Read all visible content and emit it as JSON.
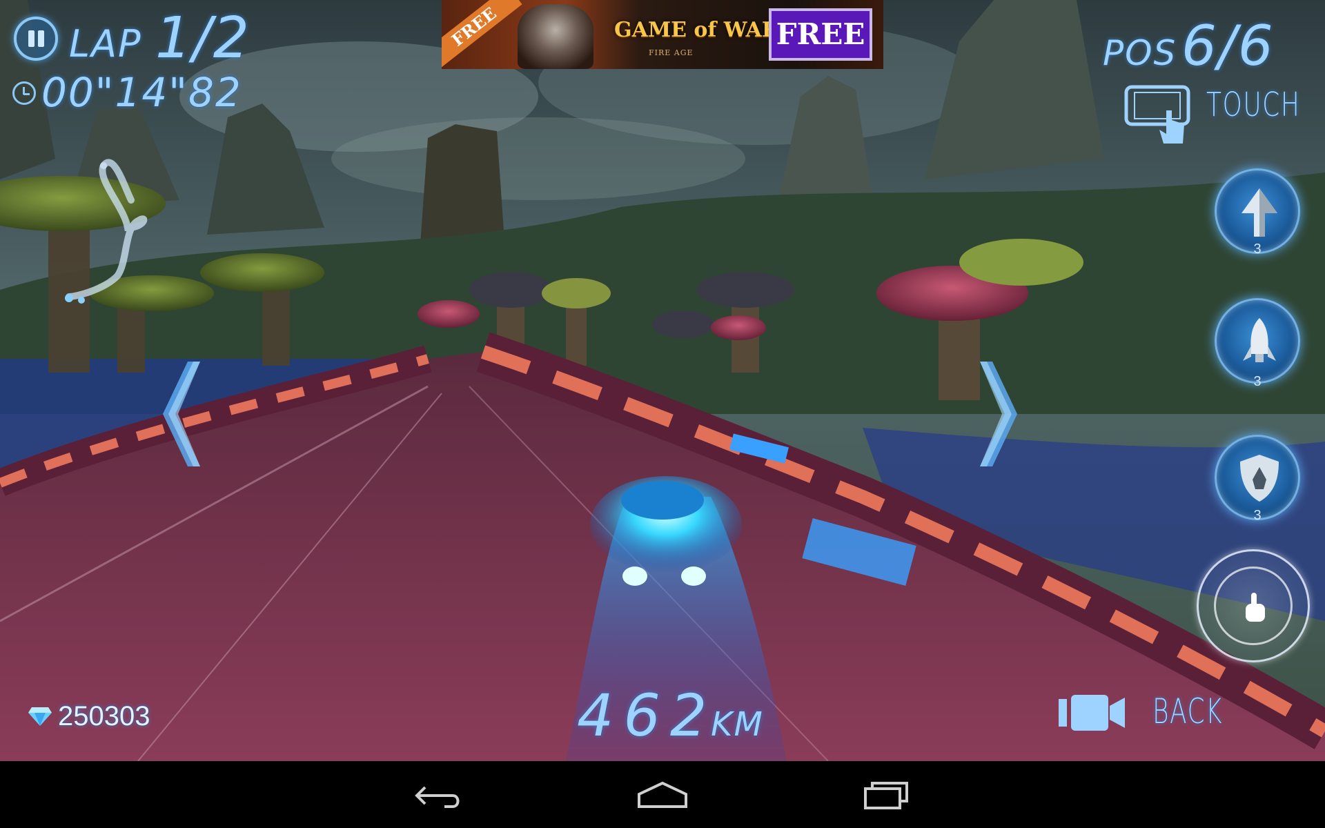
{
  "hud": {
    "lap_label": "LAP",
    "lap_value": "1/2",
    "timer": "00\"14\"82",
    "position_label": "POS",
    "position_value": "6/6",
    "control_mode": "TOUCH",
    "gems": "250303",
    "speed_value": "462",
    "speed_unit": "KM",
    "back_label": "BACK"
  },
  "powerups": [
    {
      "name": "boost",
      "count": "3"
    },
    {
      "name": "missile",
      "count": "3"
    },
    {
      "name": "shield",
      "count": "3"
    }
  ],
  "ad": {
    "ribbon": "FREE",
    "title": "GAME of WAR",
    "subtitle": "FIRE AGE",
    "button": "FREE"
  },
  "colors": {
    "hud_text": "#9fd3ff",
    "hud_glow": "#46a0ff",
    "track": "#7a3550",
    "sky": "#3a4e52"
  },
  "icons": [
    "pause-icon",
    "clock-icon",
    "phone-touch-icon",
    "boost-arrow-icon",
    "missile-icon",
    "shield-icon",
    "finger-icon",
    "camera-icon",
    "gem-icon",
    "back-nav-icon",
    "home-nav-icon",
    "recents-nav-icon"
  ]
}
